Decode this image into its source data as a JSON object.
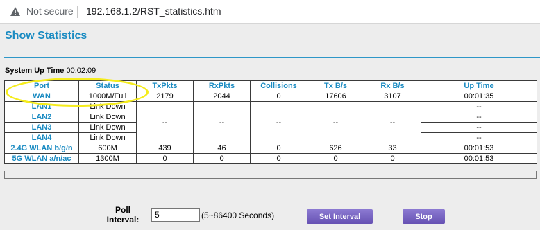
{
  "browser": {
    "security_label": "Not secure",
    "url": "192.168.1.2/RST_statistics.htm"
  },
  "page": {
    "title": "Show Statistics",
    "uptime_label": "System Up Time",
    "uptime_value": "00:02:09"
  },
  "table": {
    "headers": [
      "Port",
      "Status",
      "TxPkts",
      "RxPkts",
      "Collisions",
      "Tx B/s",
      "Rx B/s",
      "Up Time"
    ],
    "wan": {
      "port": "WAN",
      "status": "1000M/Full",
      "tx": "2179",
      "rx": "2044",
      "col": "0",
      "txb": "17606",
      "rxb": "3107",
      "up": "00:01:35"
    },
    "lan": [
      {
        "port": "LAN1",
        "status": "Link Down",
        "up": "--"
      },
      {
        "port": "LAN2",
        "status": "Link Down",
        "up": "--"
      },
      {
        "port": "LAN3",
        "status": "Link Down",
        "up": "--"
      },
      {
        "port": "LAN4",
        "status": "Link Down",
        "up": "--"
      }
    ],
    "lan_merged": {
      "tx": "--",
      "rx": "--",
      "col": "--",
      "txb": "--",
      "rxb": "--"
    },
    "wlan24": {
      "port": "2.4G WLAN b/g/n",
      "status": "600M",
      "tx": "439",
      "rx": "46",
      "col": "0",
      "txb": "626",
      "rxb": "33",
      "up": "00:01:53"
    },
    "wlan5": {
      "port": "5G WLAN a/n/ac",
      "status": "1300M",
      "tx": "0",
      "rx": "0",
      "col": "0",
      "txb": "0",
      "rxb": "0",
      "up": "00:01:53"
    }
  },
  "poll": {
    "label": "Poll Interval:",
    "value": "5",
    "hint": "(5~86400 Seconds)",
    "set_button": "Set Interval",
    "stop_button": "Stop"
  },
  "colors": {
    "accent": "#1a8bc2",
    "button": "#6b56b8",
    "highlight": "#f5ec1c"
  },
  "icons": {
    "security": "warning-triangle-icon"
  }
}
